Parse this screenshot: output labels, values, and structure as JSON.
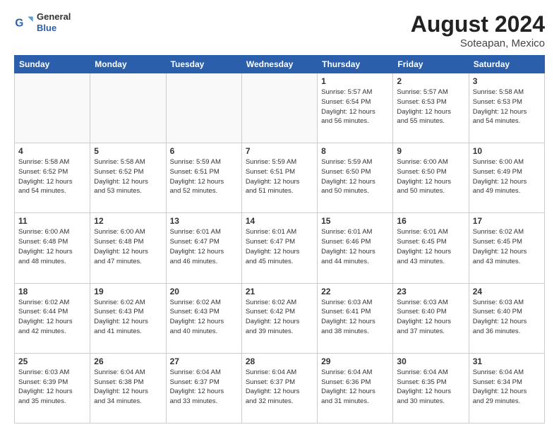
{
  "header": {
    "logo": {
      "general": "General",
      "blue": "Blue"
    },
    "title": "August 2024",
    "subtitle": "Soteapan, Mexico"
  },
  "weekdays": [
    "Sunday",
    "Monday",
    "Tuesday",
    "Wednesday",
    "Thursday",
    "Friday",
    "Saturday"
  ],
  "weeks": [
    [
      {
        "day": "",
        "info": ""
      },
      {
        "day": "",
        "info": ""
      },
      {
        "day": "",
        "info": ""
      },
      {
        "day": "",
        "info": ""
      },
      {
        "day": "1",
        "info": "Sunrise: 5:57 AM\nSunset: 6:54 PM\nDaylight: 12 hours\nand 56 minutes."
      },
      {
        "day": "2",
        "info": "Sunrise: 5:57 AM\nSunset: 6:53 PM\nDaylight: 12 hours\nand 55 minutes."
      },
      {
        "day": "3",
        "info": "Sunrise: 5:58 AM\nSunset: 6:53 PM\nDaylight: 12 hours\nand 54 minutes."
      }
    ],
    [
      {
        "day": "4",
        "info": "Sunrise: 5:58 AM\nSunset: 6:52 PM\nDaylight: 12 hours\nand 54 minutes."
      },
      {
        "day": "5",
        "info": "Sunrise: 5:58 AM\nSunset: 6:52 PM\nDaylight: 12 hours\nand 53 minutes."
      },
      {
        "day": "6",
        "info": "Sunrise: 5:59 AM\nSunset: 6:51 PM\nDaylight: 12 hours\nand 52 minutes."
      },
      {
        "day": "7",
        "info": "Sunrise: 5:59 AM\nSunset: 6:51 PM\nDaylight: 12 hours\nand 51 minutes."
      },
      {
        "day": "8",
        "info": "Sunrise: 5:59 AM\nSunset: 6:50 PM\nDaylight: 12 hours\nand 50 minutes."
      },
      {
        "day": "9",
        "info": "Sunrise: 6:00 AM\nSunset: 6:50 PM\nDaylight: 12 hours\nand 50 minutes."
      },
      {
        "day": "10",
        "info": "Sunrise: 6:00 AM\nSunset: 6:49 PM\nDaylight: 12 hours\nand 49 minutes."
      }
    ],
    [
      {
        "day": "11",
        "info": "Sunrise: 6:00 AM\nSunset: 6:48 PM\nDaylight: 12 hours\nand 48 minutes."
      },
      {
        "day": "12",
        "info": "Sunrise: 6:00 AM\nSunset: 6:48 PM\nDaylight: 12 hours\nand 47 minutes."
      },
      {
        "day": "13",
        "info": "Sunrise: 6:01 AM\nSunset: 6:47 PM\nDaylight: 12 hours\nand 46 minutes."
      },
      {
        "day": "14",
        "info": "Sunrise: 6:01 AM\nSunset: 6:47 PM\nDaylight: 12 hours\nand 45 minutes."
      },
      {
        "day": "15",
        "info": "Sunrise: 6:01 AM\nSunset: 6:46 PM\nDaylight: 12 hours\nand 44 minutes."
      },
      {
        "day": "16",
        "info": "Sunrise: 6:01 AM\nSunset: 6:45 PM\nDaylight: 12 hours\nand 43 minutes."
      },
      {
        "day": "17",
        "info": "Sunrise: 6:02 AM\nSunset: 6:45 PM\nDaylight: 12 hours\nand 43 minutes."
      }
    ],
    [
      {
        "day": "18",
        "info": "Sunrise: 6:02 AM\nSunset: 6:44 PM\nDaylight: 12 hours\nand 42 minutes."
      },
      {
        "day": "19",
        "info": "Sunrise: 6:02 AM\nSunset: 6:43 PM\nDaylight: 12 hours\nand 41 minutes."
      },
      {
        "day": "20",
        "info": "Sunrise: 6:02 AM\nSunset: 6:43 PM\nDaylight: 12 hours\nand 40 minutes."
      },
      {
        "day": "21",
        "info": "Sunrise: 6:02 AM\nSunset: 6:42 PM\nDaylight: 12 hours\nand 39 minutes."
      },
      {
        "day": "22",
        "info": "Sunrise: 6:03 AM\nSunset: 6:41 PM\nDaylight: 12 hours\nand 38 minutes."
      },
      {
        "day": "23",
        "info": "Sunrise: 6:03 AM\nSunset: 6:40 PM\nDaylight: 12 hours\nand 37 minutes."
      },
      {
        "day": "24",
        "info": "Sunrise: 6:03 AM\nSunset: 6:40 PM\nDaylight: 12 hours\nand 36 minutes."
      }
    ],
    [
      {
        "day": "25",
        "info": "Sunrise: 6:03 AM\nSunset: 6:39 PM\nDaylight: 12 hours\nand 35 minutes."
      },
      {
        "day": "26",
        "info": "Sunrise: 6:04 AM\nSunset: 6:38 PM\nDaylight: 12 hours\nand 34 minutes."
      },
      {
        "day": "27",
        "info": "Sunrise: 6:04 AM\nSunset: 6:37 PM\nDaylight: 12 hours\nand 33 minutes."
      },
      {
        "day": "28",
        "info": "Sunrise: 6:04 AM\nSunset: 6:37 PM\nDaylight: 12 hours\nand 32 minutes."
      },
      {
        "day": "29",
        "info": "Sunrise: 6:04 AM\nSunset: 6:36 PM\nDaylight: 12 hours\nand 31 minutes."
      },
      {
        "day": "30",
        "info": "Sunrise: 6:04 AM\nSunset: 6:35 PM\nDaylight: 12 hours\nand 30 minutes."
      },
      {
        "day": "31",
        "info": "Sunrise: 6:04 AM\nSunset: 6:34 PM\nDaylight: 12 hours\nand 29 minutes."
      }
    ]
  ]
}
